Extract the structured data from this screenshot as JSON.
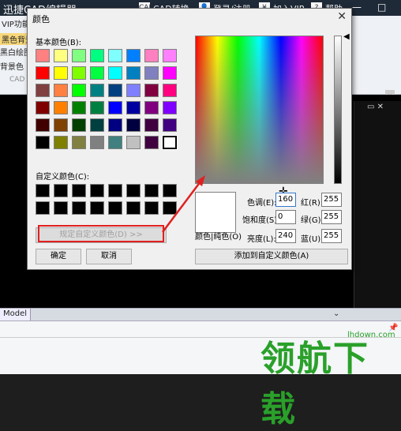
{
  "app": {
    "title": "迅捷CAD编辑器",
    "menu": [
      {
        "icon_text": "CAD",
        "label": "CAD转换"
      },
      {
        "icon_text": "👤",
        "label": "登录/注册"
      },
      {
        "icon_text": "¥",
        "label": "加入VIP"
      },
      {
        "icon_text": "?",
        "label": "帮助"
      }
    ],
    "window_controls": {
      "minimize": "—",
      "maximize": "□"
    },
    "ribbon": {
      "vip_label": "VIP功能",
      "items": [
        "黑色背景",
        "黑白绘图",
        "背景色"
      ],
      "group_label": "CAD"
    },
    "status": {
      "model_tab": "Model"
    },
    "side": {
      "scroll_down": "⌄",
      "chevron": "⌄",
      "icons": "▭ ✕"
    },
    "cmd": {
      "pin": "📌"
    }
  },
  "dialog": {
    "title": "颜色",
    "close_glyph": "✕",
    "basic_colors_label": "基本颜色(B):",
    "custom_colors_label": "自定义颜色(C):",
    "define_custom_button": "规定自定义颜色(D) >>",
    "ok_button": "确定",
    "cancel_button": "取消",
    "solid_label": "颜色|纯色(O)",
    "add_custom_button": "添加到自定义颜色(A)",
    "fields": {
      "hue": {
        "label": "色调(E):",
        "value": "160"
      },
      "sat": {
        "label": "饱和度(S):",
        "value": "0"
      },
      "lum": {
        "label": "亮度(L):",
        "value": "240"
      },
      "red": {
        "label": "红(R):",
        "value": "255"
      },
      "green": {
        "label": "绿(G):",
        "value": "255"
      },
      "blue": {
        "label": "蓝(U):",
        "value": "255"
      }
    },
    "basic_colors": [
      "#ff8080",
      "#ffff80",
      "#80ff80",
      "#00ff80",
      "#80ffff",
      "#0080ff",
      "#ff80c0",
      "#ff80ff",
      "#ff0000",
      "#ffff00",
      "#80ff00",
      "#00ff40",
      "#00ffff",
      "#0080c0",
      "#8080c0",
      "#ff00ff",
      "#804040",
      "#ff8040",
      "#00ff00",
      "#008080",
      "#004080",
      "#8080ff",
      "#800040",
      "#ff0080",
      "#800000",
      "#ff8000",
      "#008000",
      "#008040",
      "#0000ff",
      "#0000a0",
      "#800080",
      "#8000ff",
      "#400000",
      "#804000",
      "#004000",
      "#004040",
      "#000080",
      "#000040",
      "#400040",
      "#400080",
      "#000000",
      "#808000",
      "#808040",
      "#808080",
      "#408080",
      "#c0c0c0",
      "#400040",
      "#ffffff"
    ],
    "selected_color_index": 47,
    "custom_colors": [
      "#000000",
      "#000000",
      "#000000",
      "#000000",
      "#000000",
      "#000000",
      "#000000",
      "#000000",
      "#000000",
      "#000000",
      "#000000",
      "#000000",
      "#000000",
      "#000000",
      "#000000",
      "#000000"
    ],
    "annotation_color": "#e02020"
  },
  "watermark": {
    "text": "领航下载",
    "url": "lhdown.com"
  }
}
